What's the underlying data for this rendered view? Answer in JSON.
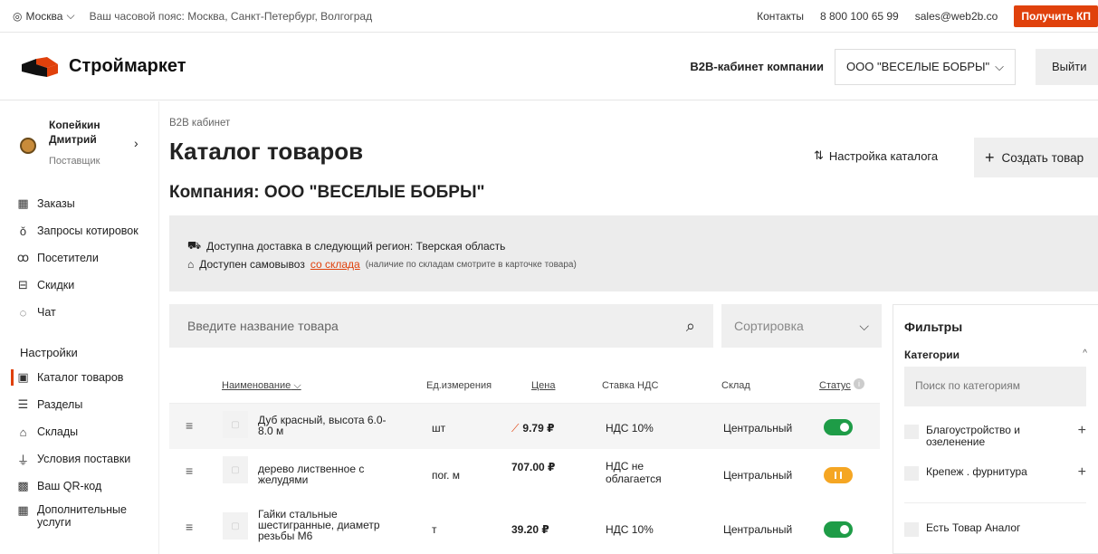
{
  "topbar": {
    "city": "Москва",
    "timezone": "Ваш часовой пояс: Москва, Санкт-Петербург, Волгоград",
    "contacts": "Контакты",
    "phone": "8 800 100 65 99",
    "email": "sales@web2b.co",
    "get_kp": "Получить КП"
  },
  "header": {
    "logo": "Строймаркет",
    "b2b_label": "B2B-кабинет компании",
    "company": "ООО \"ВЕСЕЛЫЕ БОБРЫ\"",
    "logout": "Выйти"
  },
  "user": {
    "name_line1": "Копейкин",
    "name_line2": "Дмитрий",
    "role": "Поставщик"
  },
  "menu": [
    {
      "label": "Заказы",
      "icon": "orders-icon"
    },
    {
      "label": "Запросы котировок",
      "icon": "quotes-icon"
    },
    {
      "label": "Посетители",
      "icon": "visitors-icon"
    },
    {
      "label": "Скидки",
      "icon": "discounts-icon"
    },
    {
      "label": "Чат",
      "icon": "chat-icon"
    }
  ],
  "settings": {
    "heading": "Настройки",
    "items": [
      {
        "label": "Каталог товаров",
        "icon": "catalog-icon"
      },
      {
        "label": "Разделы",
        "icon": "sections-icon"
      },
      {
        "label": "Склады",
        "icon": "warehouse-icon"
      },
      {
        "label": "Условия поставки",
        "icon": "delivery-terms-icon"
      },
      {
        "label": "Ваш QR-код",
        "icon": "qr-icon"
      },
      {
        "label": "Дополнительные услуги",
        "icon": "services-icon"
      }
    ]
  },
  "main": {
    "breadcrumb": "B2B кабинет",
    "title": "Каталог товаров",
    "company_heading": "Компания: ООО \"ВЕСЕЛЫЕ БОБРЫ\"",
    "catalog_settings": "Настройка каталога",
    "create_product": "Создать товар",
    "delivery_info": "Доступна доставка в следующий регион: Тверская область",
    "pickup_prefix": "Доступен самовывоз",
    "pickup_link": "со склада",
    "pickup_note": "(наличие по складам смотрите в карточке товара)",
    "search_placeholder": "Введите название товара",
    "sort_placeholder": "Сортировка"
  },
  "table": {
    "headers": {
      "name": "Наименование",
      "unit": "Ед.измерения",
      "price": "Цена",
      "vat": "Ставка НДС",
      "warehouse": "Склад",
      "status": "Статус"
    },
    "rows": [
      {
        "name": "Дуб красный, высота 6.0-8.0 м",
        "unit": "шт",
        "price": "9.79 ₽",
        "vat": "НДС 10%",
        "warehouse": "Центральный",
        "status": "active"
      },
      {
        "name": "дерево лиственное с желудями",
        "unit": "пог. м",
        "price": "707.00 ₽",
        "vat": "НДС не облагается",
        "warehouse": "Центральный",
        "status": "paused"
      },
      {
        "name": "Гайки стальные шестигранные, диаметр резьбы М6",
        "unit": "т",
        "price": "39.20 ₽",
        "vat": "НДС 10%",
        "warehouse": "Центральный",
        "status": "active"
      }
    ]
  },
  "filters": {
    "heading": "Фильтры",
    "categories_label": "Категории",
    "category_search_placeholder": "Поиск по категориям",
    "items": [
      {
        "label": "Благоустройство и озеленение"
      },
      {
        "label": "Крепеж . фурнитура"
      },
      {
        "label": "Есть Товар Аналог"
      }
    ]
  },
  "colors": {
    "accent": "#e0410c",
    "toggle_on": "#1e9c47",
    "toggle_paused": "#f5a623"
  }
}
